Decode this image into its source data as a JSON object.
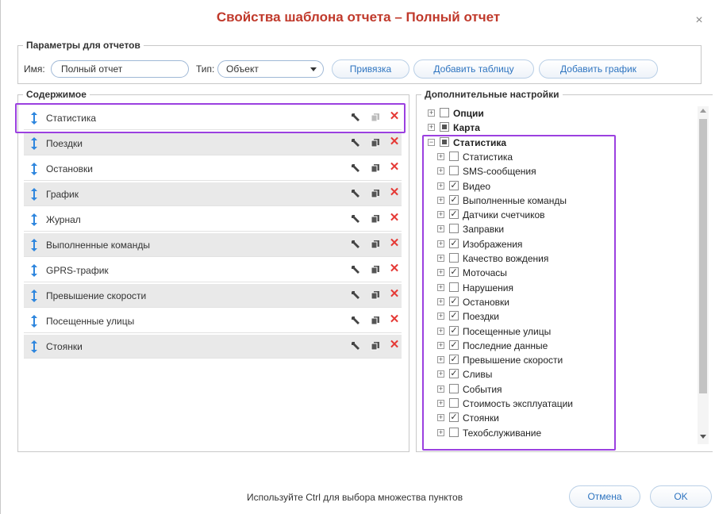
{
  "dialog": {
    "title": "Свойства шаблона отчета – Полный отчет",
    "close": "×"
  },
  "params": {
    "legend": "Параметры для отчетов",
    "name_label": "Имя:",
    "name_value": "Полный отчет",
    "type_label": "Тип:",
    "type_value": "Объект",
    "btn_bind": "Привязка",
    "btn_add_table": "Добавить таблицу",
    "btn_add_chart": "Добавить график"
  },
  "content": {
    "legend": "Содержимое",
    "rows": [
      {
        "label": "Статистика"
      },
      {
        "label": "Поездки"
      },
      {
        "label": "Остановки"
      },
      {
        "label": "График"
      },
      {
        "label": "Журнал"
      },
      {
        "label": "Выполненные команды"
      },
      {
        "label": "GPRS-трафик"
      },
      {
        "label": "Превышение скорости"
      },
      {
        "label": "Посещенные улицы"
      },
      {
        "label": "Стоянки"
      }
    ]
  },
  "extra": {
    "legend": "Дополнительные настройки",
    "tree": [
      {
        "label": "Опции",
        "level": 0,
        "checked": "none",
        "bold": true,
        "expander": "+"
      },
      {
        "label": "Карта",
        "level": 0,
        "checked": "partial",
        "bold": true,
        "expander": "+"
      },
      {
        "label": "Статистика",
        "level": 0,
        "checked": "partial",
        "bold": true,
        "expander": "−"
      },
      {
        "label": "Статистика",
        "level": 1,
        "checked": "none",
        "expander": "+"
      },
      {
        "label": "SMS-сообщения",
        "level": 1,
        "checked": "none",
        "expander": "+"
      },
      {
        "label": "Видео",
        "level": 1,
        "checked": "checked",
        "expander": "+"
      },
      {
        "label": "Выполненные команды",
        "level": 1,
        "checked": "checked",
        "expander": "+"
      },
      {
        "label": "Датчики счетчиков",
        "level": 1,
        "checked": "checked",
        "expander": "+"
      },
      {
        "label": "Заправки",
        "level": 1,
        "checked": "none",
        "expander": "+"
      },
      {
        "label": "Изображения",
        "level": 1,
        "checked": "checked",
        "expander": "+"
      },
      {
        "label": "Качество вождения",
        "level": 1,
        "checked": "none",
        "expander": "+"
      },
      {
        "label": "Моточасы",
        "level": 1,
        "checked": "checked",
        "expander": "+"
      },
      {
        "label": "Нарушения",
        "level": 1,
        "checked": "none",
        "expander": "+"
      },
      {
        "label": "Остановки",
        "level": 1,
        "checked": "checked",
        "expander": "+"
      },
      {
        "label": "Поездки",
        "level": 1,
        "checked": "checked",
        "expander": "+"
      },
      {
        "label": "Посещенные улицы",
        "level": 1,
        "checked": "checked",
        "expander": "+"
      },
      {
        "label": "Последние данные",
        "level": 1,
        "checked": "checked",
        "expander": "+"
      },
      {
        "label": "Превышение скорости",
        "level": 1,
        "checked": "checked",
        "expander": "+"
      },
      {
        "label": "Сливы",
        "level": 1,
        "checked": "checked",
        "expander": "+"
      },
      {
        "label": "События",
        "level": 1,
        "checked": "none",
        "expander": "+"
      },
      {
        "label": "Стоимость эксплуатации",
        "level": 1,
        "checked": "none",
        "expander": "+"
      },
      {
        "label": "Стоянки",
        "level": 1,
        "checked": "checked",
        "expander": "+"
      },
      {
        "label": "Техобслуживание",
        "level": 1,
        "checked": "none",
        "expander": "+"
      }
    ]
  },
  "footer": {
    "hint": "Используйте Ctrl для выбора множества пунктов",
    "cancel": "Отмена",
    "ok": "OK"
  },
  "colors": {
    "title": "#c0392b",
    "accent": "#2e74c0",
    "highlight": "#9b40e0",
    "delete": "#e53935"
  }
}
